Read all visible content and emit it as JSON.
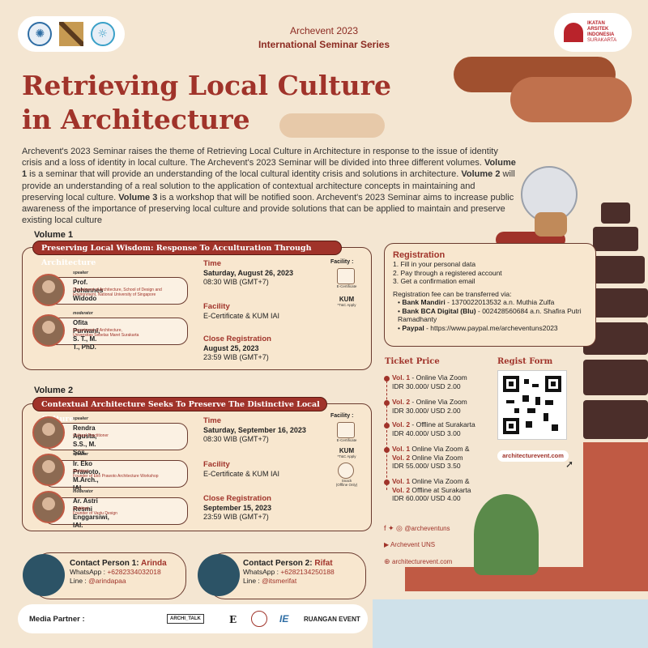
{
  "header": {
    "event_line1": "Archevent 2023",
    "event_line2": "International Seminar Series",
    "iai_logo_text": [
      "IKATAN",
      "ARSITEK",
      "INDONESIA",
      "SURAKARTA"
    ]
  },
  "title": {
    "line1": "Retrieving Local Culture",
    "line2": "in Architecture"
  },
  "intro": {
    "p1": "Archevent's 2023 Seminar raises the theme of Retrieving Local Culture in Architecture in response to the issue of identity crisis and a loss of identity in local culture. The Archevent's 2023 Seminar will be divided into three different volumes. ",
    "v1_label": "Volume 1",
    "p2": " is a seminar that will provide an understanding of the local cultural identity crisis and solutions in architecture. ",
    "v2_label": "Volume 2",
    "p3": " will provide an understanding of a real solution to the application of contextual architecture concepts in maintaining and preserving local culture. ",
    "v3_label": "Volume 3",
    "p4": " is a workshop that will be notified soon. Archevent's 2023 Seminar aims to increase public awareness of the importance of preserving local culture and provide solutions that can be applied to maintain and preserve existing local culture"
  },
  "volume1": {
    "label": "Volume 1",
    "banner": "Preserving Local Wisdom:  Response To Acculturation Through Architecture",
    "speakers": [
      {
        "role": "speaker",
        "name": "Prof. Johannes Widodo",
        "aff1": "Department of Architecture, School of Design and",
        "aff2": "Environment, National University of Singapore"
      },
      {
        "role": "moderator",
        "name": "Ofita Purwani, S. T., M. T., PhD.",
        "aff1": "Department of Architecture,",
        "aff2": "Universitas Sebelas Maret Surakarta"
      }
    ],
    "time_head": "Time",
    "time_date": "Saturday, August 26, 2023",
    "time_hour": "08:30 WIB (GMT+7)",
    "facility_head": "Facility",
    "facility_val": "E-Certificate & KUM IAI",
    "close_head": "Close Registration",
    "close_date": "August 25, 2023",
    "close_hour": "23:59 WIB (GMT+7)",
    "fac_label": "Facility :",
    "fac_cert": "E-Certificate",
    "fac_kum": "KUM",
    "fac_kum_note": "*T&C Apply"
  },
  "volume2": {
    "label": "Volume 2",
    "banner": "Contextual Architecture Seeks To Preserve The Distinctive Local Culture",
    "speakers": [
      {
        "role": "speaker",
        "name": "Rendra Agusta, S.S., M. Sos.",
        "aff1": "Cultural Practitioner",
        "aff2": ""
      },
      {
        "role": "speaker",
        "name": "Ir. Eko Prawoto, M.Arch., IAI",
        "aff1": "Architect,",
        "aff2": "Founder of Eko Prawoto Architecture Workshop"
      },
      {
        "role": "moderator",
        "name": "Ar. Astri Resmi Enggarsiwi, IAI.",
        "aff1": "Architect,",
        "aff2": "Founder of Vastu Design"
      }
    ],
    "time_head": "Time",
    "time_date": "Saturday, September 16, 2023",
    "time_hour": "08:30 WIB (GMT+7)",
    "facility_head": "Facility",
    "facility_val": "E-Certificate & KUM IAI",
    "close_head": "Close Registration",
    "close_date": "September 15, 2023",
    "close_hour": "23:59 WIB (GMT+7)",
    "fac_label": "Facility :",
    "fac_cert": "E-Certificate",
    "fac_kum": "KUM",
    "fac_kum_note": "*T&C Apply",
    "fac_snack": "Snack",
    "fac_snack_note": "(Offline Only)"
  },
  "registration": {
    "title": "Registration",
    "steps": [
      "1. Fill in your personal data",
      "2. Pay through a registered account",
      "3. Get a confirmation email"
    ],
    "transfer_intro": "Registration fee can be transferred via:",
    "banks": [
      {
        "name": "Bank Mandiri",
        "detail": " - 1370022013532 a.n. Muthia Zulfa"
      },
      {
        "name": "Bank BCA Digital (Blu)",
        "detail": " - 002428560684 a.n. Shafira Putri Ramadhanty"
      },
      {
        "name": "Paypal",
        "detail": " - https://www.paypal.me/archeventuns2023"
      }
    ]
  },
  "tickets": {
    "title": "Ticket Price",
    "items": [
      {
        "a": "Vol. 1",
        "a_rest": " - Online Via Zoom",
        "b": "",
        "b_rest": "",
        "price": "IDR 30.000/ USD 2.00"
      },
      {
        "a": "Vol. 2",
        "a_rest": " - Online Via Zoom",
        "b": "",
        "b_rest": "",
        "price": "IDR 30.000/ USD 2.00"
      },
      {
        "a": "Vol. 2",
        "a_rest": " - Offline at Surakarta",
        "b": "",
        "b_rest": "",
        "price": "IDR 40.000/ USD 3.00"
      },
      {
        "a": "Vol. 1",
        "a_rest": " Online Via Zoom &",
        "b": "Vol. 2",
        "b_rest": " Online Via Zoom",
        "price": "IDR 55.000/ USD 3.50"
      },
      {
        "a": "Vol. 1",
        "a_rest": " Online Via Zoom &",
        "b": "Vol. 2",
        "b_rest": " Offline at Surakarta",
        "price": "IDR 60.000/ USD 4.00"
      }
    ]
  },
  "regist_form": {
    "title": "Regist Form",
    "url": "architecturevent.com"
  },
  "social": {
    "instagram": "@archeventuns",
    "youtube": "Archevent UNS",
    "website": "architecturevent.com"
  },
  "contacts": [
    {
      "label": "Contact Person 1: ",
      "name": "Arinda",
      "wa_label": "WhatsApp : ",
      "wa": "+6282334032018",
      "line_label": "Line : ",
      "line": "@arindapaa"
    },
    {
      "label": "Contact Person 2: ",
      "name": "Rifat",
      "wa_label": "WhatsApp : ",
      "wa": "+6282134250188",
      "line_label": "Line : ",
      "line": "@itsmerifat"
    }
  ],
  "media": {
    "label": "Media Partner :",
    "partners": [
      "ARCHI_TALK",
      "E",
      "IE",
      "RUANGAN EVENT"
    ]
  },
  "colors": {
    "primary": "#a0332a",
    "background": "#f4e6d2",
    "card": "#f8e7cf",
    "dark": "#4b2e2a"
  }
}
